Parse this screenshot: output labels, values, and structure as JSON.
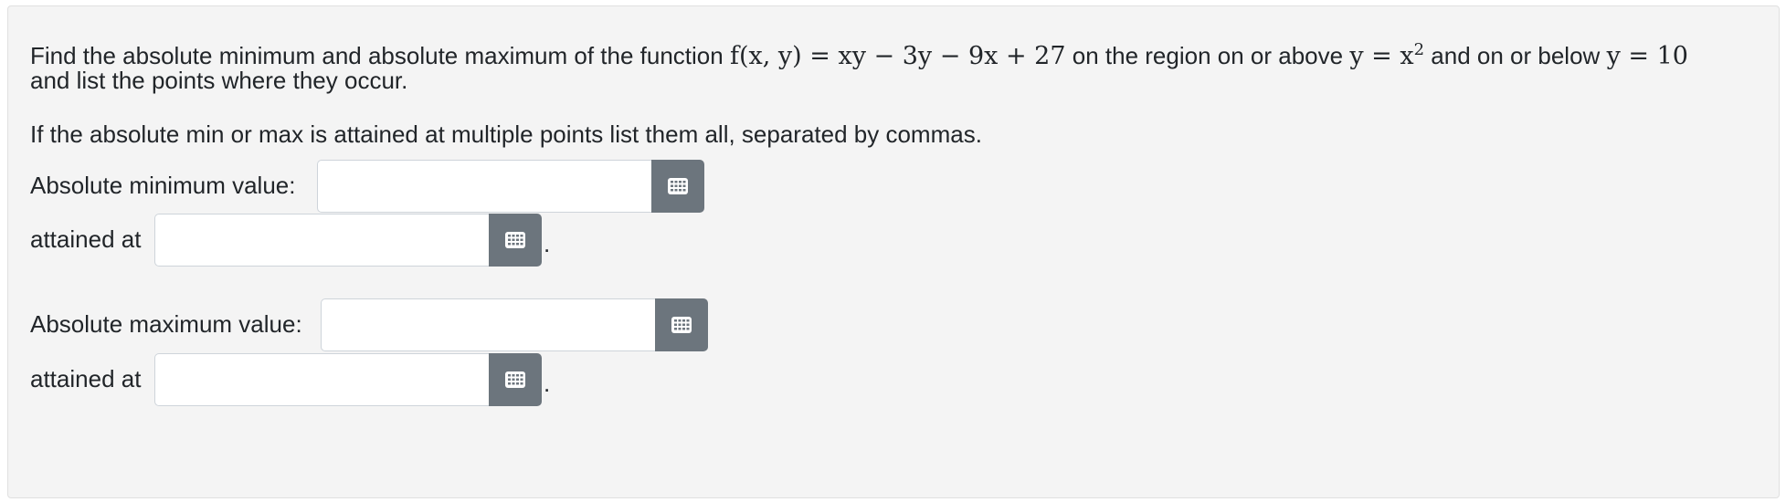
{
  "question": {
    "intro": "Find the absolute minimum and absolute maximum of the function",
    "function_expr": "f(x, y) = xy − 3y − 9x + 27",
    "region_text_1": "on the region on or above",
    "lower_curve": "y = x",
    "lower_curve_exp": "2",
    "region_text_2": "and on or below",
    "upper_line": "y = 10",
    "line2": "and list the points where they occur.",
    "instructions": "If the absolute min or max is attained at multiple points list them all, separated by commas."
  },
  "fields": {
    "min_value_label": "Absolute minimum value:",
    "min_value": "",
    "min_attained_label": "attained at",
    "min_attained": "",
    "max_value_label": "Absolute maximum value:",
    "max_value": "",
    "max_attained_label": "attained at",
    "max_attained": "",
    "period": "."
  },
  "icons": {
    "keyboard_button": "keyboard-icon"
  },
  "colors": {
    "button_bg": "#6c757d",
    "panel_bg": "#f4f4f4",
    "input_border": "#ced4da"
  }
}
